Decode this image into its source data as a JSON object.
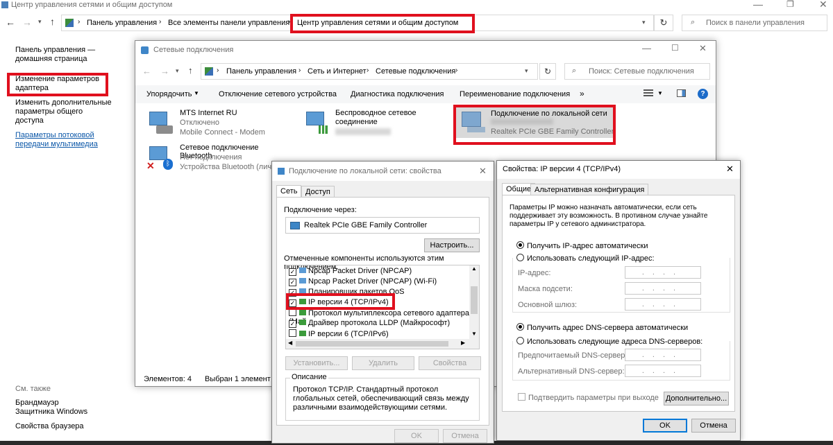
{
  "main_window": {
    "title": "Центр управления сетями и общим доступом",
    "breadcrumb": [
      "Панель управления",
      "Все элементы панели управления",
      "Центр управления сетями и общим доступом"
    ],
    "search_placeholder": "Поиск в панели управления",
    "sidebar": {
      "home": "Панель управления — домашняя страница",
      "change_adapter": "Изменение параметров адаптера",
      "sharing": "Изменить дополнительные параметры общего доступа",
      "streaming": "Параметры потоковой передачи мультимедиа",
      "see_also": "См. также",
      "firewall": "Брандмауэр Защитника Windows",
      "browser": "Свойства браузера"
    }
  },
  "net_window": {
    "title": "Сетевые подключения",
    "breadcrumb": [
      "Панель управления",
      "Сеть и Интернет",
      "Сетевые подключения"
    ],
    "search_placeholder": "Поиск: Сетевые подключения",
    "toolbar": [
      "Упорядочить",
      "Отключение сетевого устройства",
      "Диагностика подключения",
      "Переименование подключения",
      "»"
    ],
    "items": [
      {
        "name": "MTS Internet RU",
        "status": "Отключено",
        "device": "Mobile Connect - Modem"
      },
      {
        "name": "Беспроводное сетевое соединение",
        "status": "",
        "device": ""
      },
      {
        "name": "Подключение по локальной сети",
        "status": "",
        "device": "Realtek PCIe GBE Family Controller"
      },
      {
        "name": "Сетевое подключение Bluetooth",
        "status": "Нет подключения",
        "device": "Устройства Bluetooth (личн"
      }
    ],
    "statusbar": {
      "count": "Элементов: 4",
      "selected": "Выбран 1 элемент"
    }
  },
  "props_dialog": {
    "title": "Подключение по локальной сети: свойства",
    "tabs": [
      "Сеть",
      "Доступ"
    ],
    "connect_via": "Подключение через:",
    "adapter": "Realtek PCIe GBE Family Controller",
    "configure": "Настроить...",
    "components_label": "Отмеченные компоненты используются этим подключением:",
    "components": [
      {
        "label": "Npcap Packet Driver (NPCAP)",
        "checked": true
      },
      {
        "label": "Npcap Packet Driver (NPCAP) (Wi-Fi)",
        "checked": true
      },
      {
        "label": "Планировщик пакетов QoS",
        "checked": true
      },
      {
        "label": "IP версии 4 (TCP/IPv4)",
        "checked": true
      },
      {
        "label": "Протокол мультиплексора сетевого адаптера (Май",
        "checked": false
      },
      {
        "label": "Драйвер протокола LLDP (Майкрософт)",
        "checked": true
      },
      {
        "label": "IP версии 6 (TCP/IPv6)",
        "checked": false
      }
    ],
    "install": "Установить...",
    "remove": "Удалить",
    "properties": "Свойства",
    "desc_title": "Описание",
    "desc_text": "Протокол TCP/IP. Стандартный протокол глобальных сетей, обеспечивающий связь между различными взаимодействующими сетями.",
    "ok": "OK",
    "cancel": "Отмена"
  },
  "ipv4_dialog": {
    "title": "Свойства: IP версии 4 (TCP/IPv4)",
    "tabs": [
      "Общие",
      "Альтернативная конфигурация"
    ],
    "intro": "Параметры IP можно назначать автоматически, если сеть поддерживает эту возможность. В противном случае узнайте параметры IP у сетевого администратора.",
    "auto_ip": "Получить IP-адрес автоматически",
    "manual_ip": "Использовать следующий IP-адрес:",
    "ip_label": "IP-адрес:",
    "mask_label": "Маска подсети:",
    "gateway_label": "Основной шлюз:",
    "auto_dns": "Получить адрес DNS-сервера автоматически",
    "manual_dns": "Использовать следующие адреса DNS-серверов:",
    "dns1_label": "Предпочитаемый DNS-сервер:",
    "dns2_label": "Альтернативный DNS-сервер:",
    "validate": "Подтвердить параметры при выходе",
    "advanced": "Дополнительно...",
    "ok": "OK",
    "cancel": "Отмена",
    "dots": "...."
  }
}
